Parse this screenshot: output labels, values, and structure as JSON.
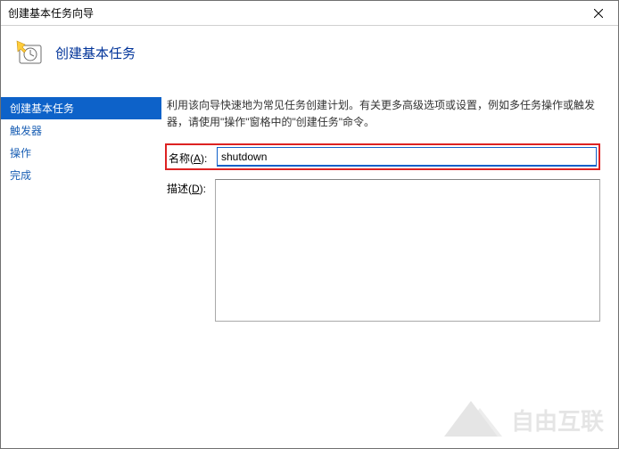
{
  "window": {
    "title": "创建基本任务向导"
  },
  "header": {
    "title": "创建基本任务"
  },
  "sidebar": {
    "items": [
      {
        "label": "创建基本任务",
        "active": true
      },
      {
        "label": "触发器",
        "active": false
      },
      {
        "label": "操作",
        "active": false
      },
      {
        "label": "完成",
        "active": false
      }
    ]
  },
  "main": {
    "intro": "利用该向导快速地为常见任务创建计划。有关更多高级选项或设置，例如多任务操作或触发器，请使用\"操作\"窗格中的\"创建任务\"命令。",
    "name_label_pre": "名称(",
    "name_label_u": "A",
    "name_label_post": "):",
    "name_value": "shutdown",
    "desc_label_pre": "描述(",
    "desc_label_u": "D",
    "desc_label_post": "):",
    "desc_value": ""
  },
  "watermark": {
    "text": "自由互联"
  }
}
